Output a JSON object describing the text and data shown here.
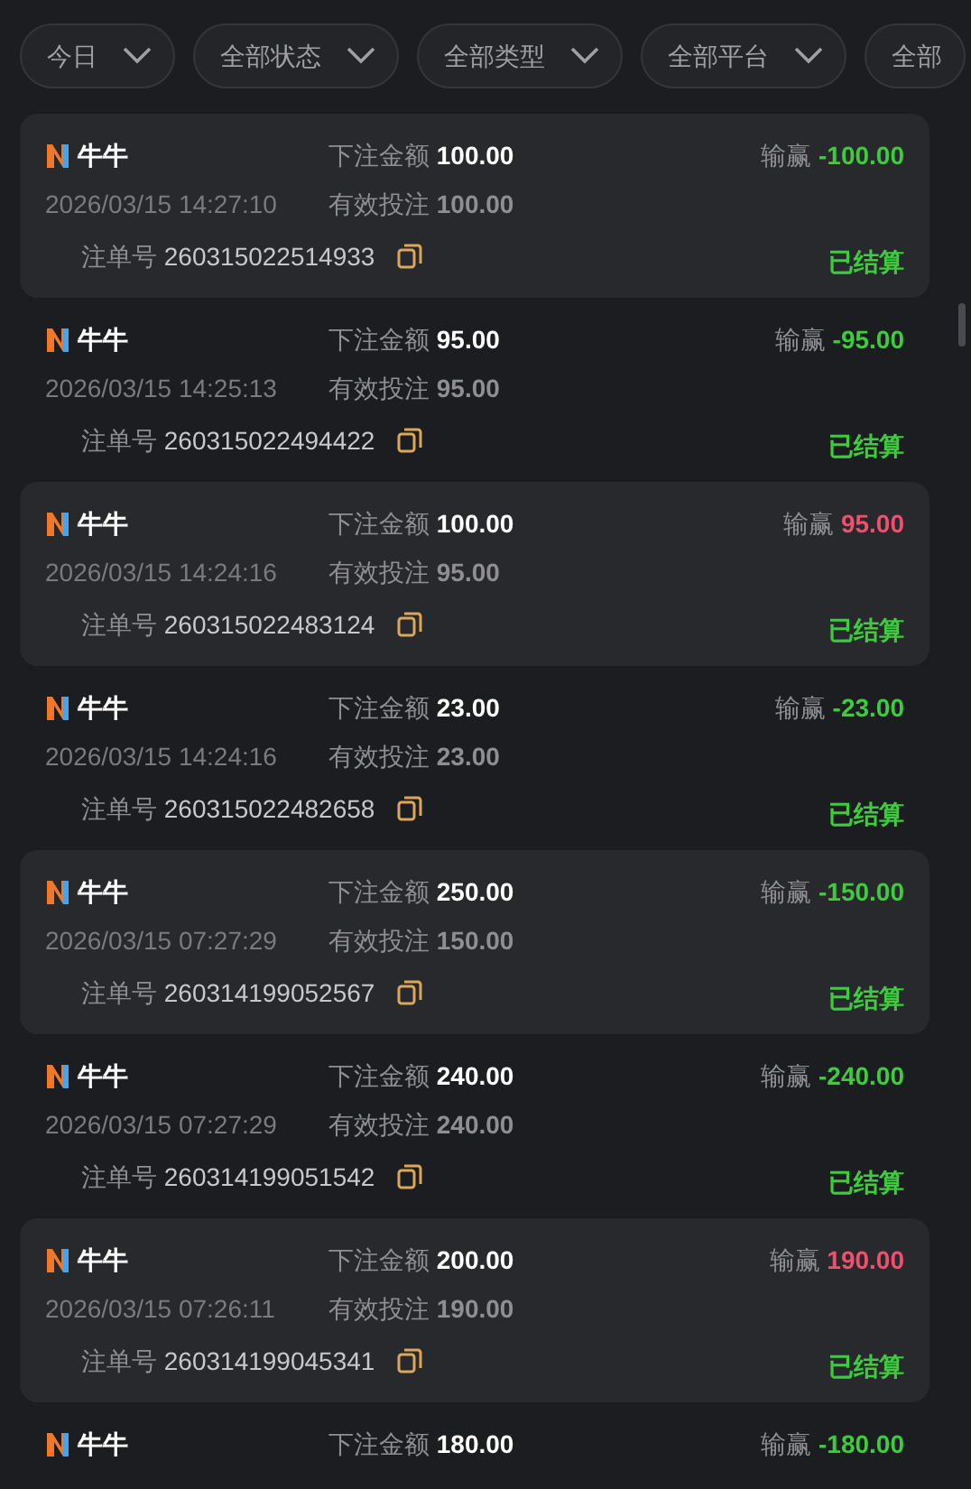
{
  "filters": [
    {
      "label": "今日",
      "chevron": true
    },
    {
      "label": "全部状态",
      "chevron": true
    },
    {
      "label": "全部类型",
      "chevron": true
    },
    {
      "label": "全部平台",
      "chevron": true
    },
    {
      "label": "全部",
      "chevron": false
    }
  ],
  "bets": [
    {
      "game": "牛牛",
      "bet_label": "下注金额",
      "bet": "100.00",
      "win_label": "输赢",
      "win": "-100.00",
      "kind": "loss",
      "time": "2026/03/15 14:27:10",
      "valid_label": "有效投注",
      "valid": "100.00",
      "order_label": "注单号",
      "order": "260315022514933",
      "status": "已结算"
    },
    {
      "game": "牛牛",
      "bet_label": "下注金额",
      "bet": "95.00",
      "win_label": "输赢",
      "win": "-95.00",
      "kind": "loss",
      "time": "2026/03/15 14:25:13",
      "valid_label": "有效投注",
      "valid": "95.00",
      "order_label": "注单号",
      "order": "260315022494422",
      "status": "已结算"
    },
    {
      "game": "牛牛",
      "bet_label": "下注金额",
      "bet": "100.00",
      "win_label": "输赢",
      "win": "95.00",
      "kind": "win",
      "time": "2026/03/15 14:24:16",
      "valid_label": "有效投注",
      "valid": "95.00",
      "order_label": "注单号",
      "order": "260315022483124",
      "status": "已结算"
    },
    {
      "game": "牛牛",
      "bet_label": "下注金额",
      "bet": "23.00",
      "win_label": "输赢",
      "win": "-23.00",
      "kind": "loss",
      "time": "2026/03/15 14:24:16",
      "valid_label": "有效投注",
      "valid": "23.00",
      "order_label": "注单号",
      "order": "260315022482658",
      "status": "已结算"
    },
    {
      "game": "牛牛",
      "bet_label": "下注金额",
      "bet": "250.00",
      "win_label": "输赢",
      "win": "-150.00",
      "kind": "loss",
      "time": "2026/03/15 07:27:29",
      "valid_label": "有效投注",
      "valid": "150.00",
      "order_label": "注单号",
      "order": "260314199052567",
      "status": "已结算"
    },
    {
      "game": "牛牛",
      "bet_label": "下注金额",
      "bet": "240.00",
      "win_label": "输赢",
      "win": "-240.00",
      "kind": "loss",
      "time": "2026/03/15 07:27:29",
      "valid_label": "有效投注",
      "valid": "240.00",
      "order_label": "注单号",
      "order": "260314199051542",
      "status": "已结算"
    },
    {
      "game": "牛牛",
      "bet_label": "下注金额",
      "bet": "200.00",
      "win_label": "输赢",
      "win": "190.00",
      "kind": "win",
      "time": "2026/03/15 07:26:11",
      "valid_label": "有效投注",
      "valid": "190.00",
      "order_label": "注单号",
      "order": "260314199045341",
      "status": "已结算"
    },
    {
      "game": "牛牛",
      "bet_label": "下注金额",
      "bet": "180.00",
      "win_label": "输赢",
      "win": "-180.00",
      "kind": "loss"
    }
  ]
}
